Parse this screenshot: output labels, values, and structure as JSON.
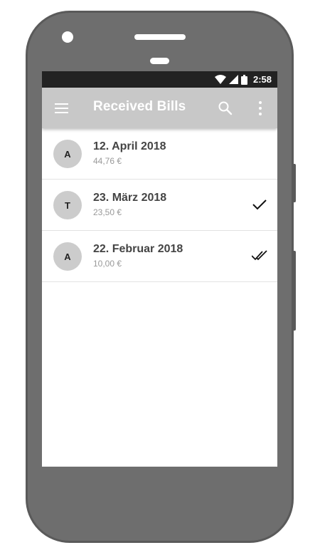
{
  "status_bar": {
    "time": "2:58"
  },
  "app_bar": {
    "title": "Received Bills"
  },
  "bills": [
    {
      "avatar": "A",
      "date": "12. April 2018",
      "amount": "44,76 €",
      "status": "none"
    },
    {
      "avatar": "T",
      "date": "23. März 2018",
      "amount": "23,50 €",
      "status": "single-check"
    },
    {
      "avatar": "A",
      "date": "22. Februar 2018",
      "amount": "10,00 €",
      "status": "double-check"
    }
  ],
  "colors": {
    "frame": "#6e6e6e",
    "status_bar": "#222222",
    "app_bar": "#c8c8c8",
    "avatar": "#cccccc"
  },
  "icons": {
    "menu": "menu-icon",
    "search": "search-icon",
    "more": "more-vert-icon",
    "single_check": "check-icon",
    "double_check": "double-check-icon"
  }
}
